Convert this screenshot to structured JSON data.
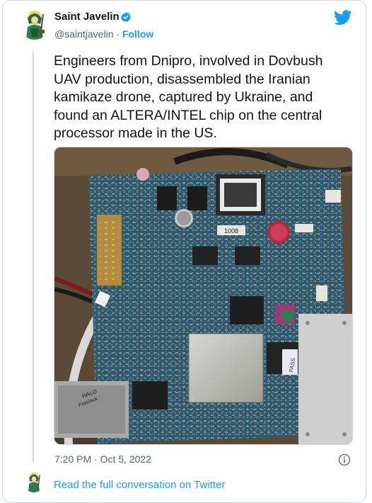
{
  "author": {
    "name": "Saint Javelin",
    "handle": "@saintjavelin",
    "separator": "·",
    "follow_label": "Follow",
    "verified": true
  },
  "tweet": {
    "text": "Engineers from Dnipro, involved in Dovbush UAV production, disassembled the Iranian kamikaze drone, captured by Ukraine, and found an ALTERA/INTEL chip on the central processor made in the US.",
    "timestamp": "7:20 PM · Oct 5, 2022"
  },
  "photo": {
    "chip_text": "1008",
    "connector_text_1": "HALO",
    "connector_text_2": "FastJack",
    "sticker_text": "PASS"
  },
  "footer": {
    "read_more": "Read the full conversation on Twitter"
  },
  "icons": {
    "bird": "twitter-bird-icon",
    "verified": "verified-badge-icon",
    "info": "info-icon"
  },
  "colors": {
    "accent": "#1d9bf0",
    "text": "#0f1419",
    "muted": "#536471",
    "border": "#cfd9de"
  }
}
